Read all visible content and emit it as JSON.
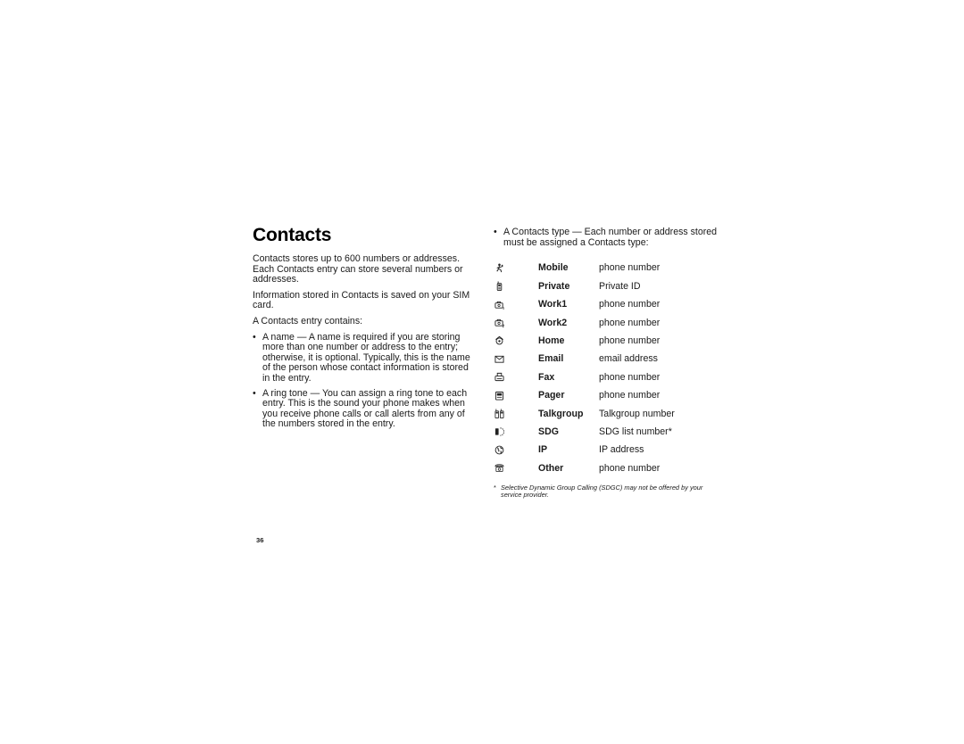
{
  "title": "Contacts",
  "intro": [
    "Contacts stores up to 600 numbers or addresses. Each Contacts entry can store several numbers or addresses.",
    "Information stored in Contacts is saved on your SIM card.",
    "A Contacts entry contains:"
  ],
  "entry_items": [
    "A name — A name is required if you are storing more than one number or address to the entry; otherwise, it is optional. Typically, this is the name of the person whose contact information is stored in the entry.",
    "A ring tone — You can assign a ring tone to each entry. This is the sound your phone makes when you receive phone calls or call alerts from any of the numbers stored in the entry."
  ],
  "type_intro": "A Contacts type — Each number or address stored must be assigned a Contacts type:",
  "bullet_glyph": "•",
  "contact_types": [
    {
      "icon": "mobile-icon",
      "name": "Mobile",
      "desc": "phone number"
    },
    {
      "icon": "private-icon",
      "name": "Private",
      "desc": "Private ID"
    },
    {
      "icon": "work1-icon",
      "name": "Work1",
      "desc": "phone number"
    },
    {
      "icon": "work2-icon",
      "name": "Work2",
      "desc": "phone number"
    },
    {
      "icon": "home-icon",
      "name": "Home",
      "desc": "phone number"
    },
    {
      "icon": "email-icon",
      "name": "Email",
      "desc": "email address"
    },
    {
      "icon": "fax-icon",
      "name": "Fax",
      "desc": "phone number"
    },
    {
      "icon": "pager-icon",
      "name": "Pager",
      "desc": "phone number"
    },
    {
      "icon": "talkgroup-icon",
      "name": "Talkgroup",
      "desc": "Talkgroup number"
    },
    {
      "icon": "sdg-icon",
      "name": "SDG",
      "desc": "SDG list number*"
    },
    {
      "icon": "ip-icon",
      "name": "IP",
      "desc": "IP address"
    },
    {
      "icon": "other-icon",
      "name": "Other",
      "desc": "phone number"
    }
  ],
  "footnote": {
    "marker": "*",
    "text": "Selective Dynamic Group Calling (SDGC) may not be offered by your service provider."
  },
  "page_number": "36"
}
